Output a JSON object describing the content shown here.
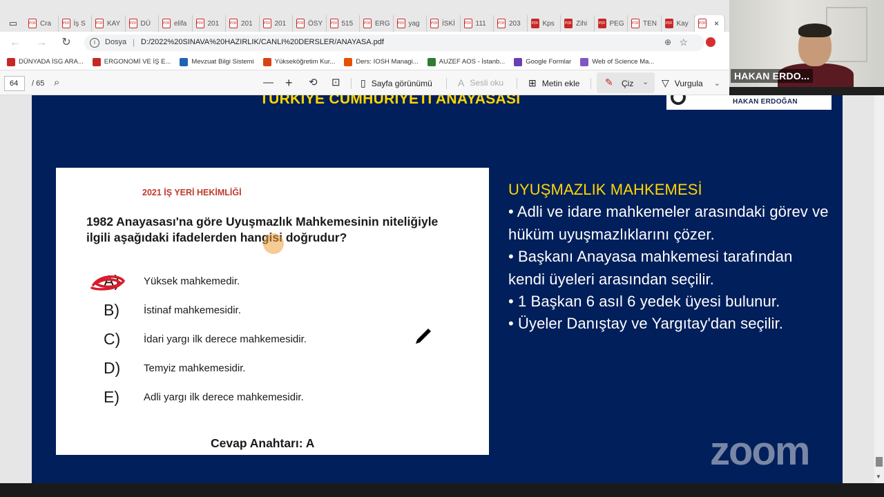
{
  "browser": {
    "tabs": [
      {
        "label": "Cra"
      },
      {
        "label": "İş S"
      },
      {
        "label": "KAY"
      },
      {
        "label": "DÜ"
      },
      {
        "label": "elifa"
      },
      {
        "label": "201"
      },
      {
        "label": "201"
      },
      {
        "label": "201"
      },
      {
        "label": "ÖSY"
      },
      {
        "label": "515"
      },
      {
        "label": "ERG"
      },
      {
        "label": "yag"
      },
      {
        "label": "İSKİ"
      },
      {
        "label": "111"
      },
      {
        "label": "203"
      },
      {
        "label": "Kps"
      },
      {
        "label": "Zihi"
      },
      {
        "label": "PEG"
      },
      {
        "label": "TEN"
      },
      {
        "label": "Kay"
      }
    ],
    "active_tab_close": "×",
    "address": {
      "protocol_label": "Dosya",
      "separator": "|",
      "url": "D:/2022%20SINAVA%20HAZIRLIK/CANLI%20DERSLER/ANAYASA.pdf"
    },
    "bookmarks": [
      {
        "label": "DÜNYADA İSG ARA...",
        "color": "#c62828"
      },
      {
        "label": "ERGONOMİ VE İŞ E...",
        "color": "#c62828"
      },
      {
        "label": "Mevzuat Bilgi Sistemi",
        "color": "#1e63b5"
      },
      {
        "label": "Yükseköğretim Kur...",
        "color": "#d84315"
      },
      {
        "label": "Ders: IOSH Managi...",
        "color": "#e65100"
      },
      {
        "label": "AUZEF AOS - İstanb...",
        "color": "#2e7d32"
      },
      {
        "label": "Google Formlar",
        "color": "#6a3fb5"
      },
      {
        "label": "Web of Science Ma...",
        "color": "#7e57c2"
      }
    ]
  },
  "pdf_toolbar": {
    "page_current": "64",
    "page_total": "/ 65",
    "page_view_label": "Sayfa görünümü",
    "read_aloud_label": "Sesli oku",
    "add_text_label": "Metin ekle",
    "draw_label": "Çiz",
    "highlight_label": "Vurgula"
  },
  "slide": {
    "title": "TÜRKİYE CUMHURİYETİ ANAYASASI",
    "logo_name": "HAKAN ERDOĞAN",
    "question": {
      "year_label": "2021 İŞ YERİ HEKİMLİĞİ",
      "text": "1982 Anayasası'na göre Uyuşmazlık Mahkemesinin niteliğiyle ilgili aşağıdaki ifadelerden hangisi doğrudur?",
      "options": [
        {
          "letter": "A)",
          "text": "Yüksek mahkemedir."
        },
        {
          "letter": "B)",
          "text": "İstinaf mahkemesidir."
        },
        {
          "letter": "C)",
          "text": "İdari yargı ilk derece mahkemesidir."
        },
        {
          "letter": "D)",
          "text": "Temyiz mahkemesidir."
        },
        {
          "letter": "E)",
          "text": "Adli yargı ilk derece mahkemesidir."
        }
      ],
      "answer_key": "Cevap Anahtarı: A"
    },
    "notes": {
      "heading": "UYUŞMAZLIK MAHKEMESİ",
      "bullets": [
        "• Adli ve idare mahkemeler arasındaki görev ve hüküm uyuşmazlıklarını çözer.",
        "• Başkanı Anayasa mahkemesi tarafından kendi üyeleri arasından seçilir.",
        "• 1 Başkan 6 asıl 6 yedek üyesi bulunur.",
        "• Üyeler Danıştay ve Yargıtay'dan seçilir."
      ]
    }
  },
  "zoom": {
    "logo_text": "zoom",
    "participant_name": "HAKAN ERDO..."
  },
  "colors": {
    "slide_bg": "#001f5b",
    "title_yellow": "#ffd700",
    "year_red": "#c0392b"
  }
}
